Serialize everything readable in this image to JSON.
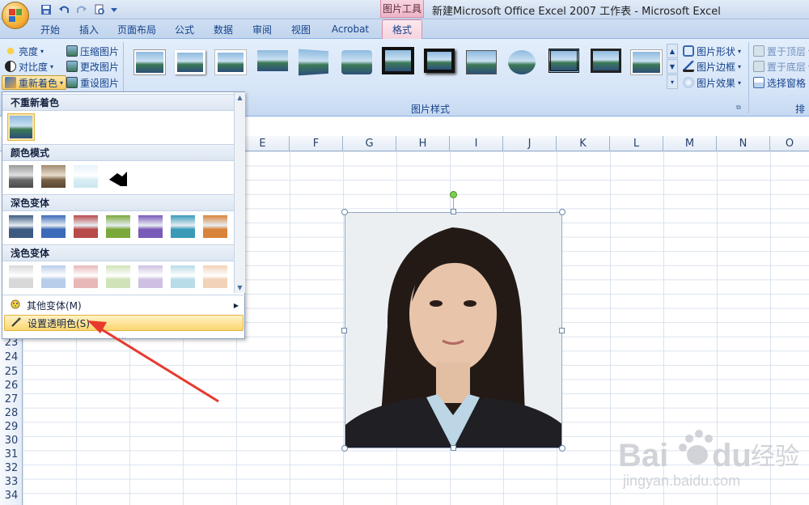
{
  "window": {
    "context_tab_title": "图片工具",
    "title": "新建Microsoft Office Excel 2007 工作表 - Microsoft Excel"
  },
  "quick_access": [
    "save-icon",
    "undo-icon",
    "redo-icon",
    "print-preview-icon",
    "customize-icon"
  ],
  "tabs": [
    {
      "label": "开始"
    },
    {
      "label": "插入"
    },
    {
      "label": "页面布局"
    },
    {
      "label": "公式"
    },
    {
      "label": "数据"
    },
    {
      "label": "审阅"
    },
    {
      "label": "视图"
    },
    {
      "label": "Acrobat"
    },
    {
      "label": "格式",
      "active": true
    }
  ],
  "ribbon": {
    "adjust": {
      "brightness": "亮度",
      "contrast": "对比度",
      "recolor": "重新着色",
      "compress": "压缩图片",
      "change": "更改图片",
      "reset": "重设图片"
    },
    "picture_styles": {
      "label": "图片样式",
      "shape": "图片形状",
      "border": "图片边框",
      "effects": "图片效果"
    },
    "arrange": {
      "bring_front": "置于顶层",
      "send_back": "置于底层",
      "selection_pane": "选择窗格",
      "label": "排列"
    }
  },
  "sheet": {
    "columns": [
      "E",
      "F",
      "G",
      "H",
      "I",
      "J",
      "K",
      "L",
      "M",
      "N",
      "O"
    ],
    "rows": [
      "23",
      "24",
      "25",
      "26",
      "27",
      "28",
      "29",
      "30",
      "31",
      "32",
      "33",
      "34"
    ]
  },
  "dropdown": {
    "no_recolor": "不重新着色",
    "color_modes": "颜色模式",
    "dark_variations": "深色变体",
    "light_variations": "浅色变体",
    "more_variations": "其他变体(M)",
    "set_transparent": "设置透明色(S)",
    "dark_colors": [
      "#3d5a80",
      "#3a6ab8",
      "#b84a4a",
      "#7aa83a",
      "#7a5ab8",
      "#3a9ab8",
      "#d8843a"
    ],
    "light_colors": [
      "#d8d8d8",
      "#b8cdea",
      "#e8b8b8",
      "#d0e2b8",
      "#cec0e2",
      "#b8dce8",
      "#f2d2b8"
    ]
  },
  "watermark": {
    "brand": "Bai du 经验",
    "url": "jingyan.baidu.com"
  },
  "colors": {
    "accent_blue": "#15428b",
    "context_pink": "#eeb4c7",
    "highlight": "#fcd66e",
    "arrow_red": "#e8392d"
  }
}
